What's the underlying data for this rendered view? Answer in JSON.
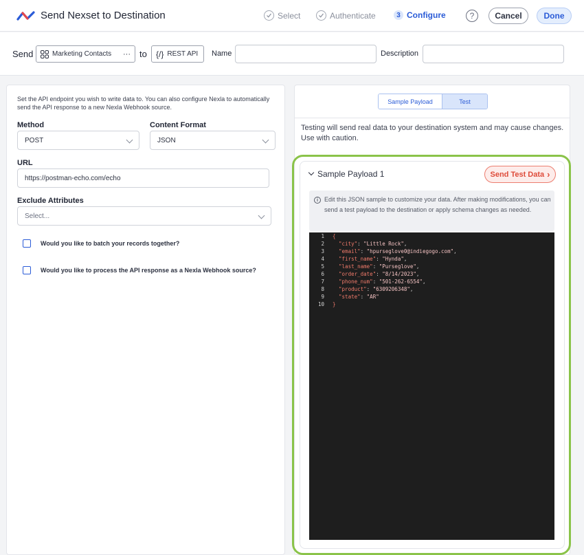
{
  "header": {
    "title": "Send Nexset to Destination",
    "steps": [
      {
        "label": "Select"
      },
      {
        "label": "Authenticate"
      },
      {
        "number": "3",
        "label": "Configure"
      }
    ],
    "help_icon_text": "?",
    "cancel_label": "Cancel",
    "done_label": "Done"
  },
  "send_bar": {
    "send_label": "Send",
    "source_name": "Marketing Contacts",
    "source_more": "···",
    "to_label": "to",
    "destination_icon_text": "{/}",
    "destination_name": "REST API",
    "name_label": "Name",
    "name_value": "",
    "description_label": "Description",
    "description_value": ""
  },
  "left_panel": {
    "intro": "Set the API endpoint you wish to write data to. You can also configure Nexla to automatically send the API response to a new Nexla Webhook source.",
    "method_label": "Method",
    "method_value": "POST",
    "content_format_label": "Content Format",
    "content_format_value": "JSON",
    "url_label": "URL",
    "url_value": "https://postman-echo.com/echo",
    "exclude_label": "Exclude Attributes",
    "exclude_placeholder": "Select...",
    "checkbox_batch": "Would you like to batch your records together?",
    "checkbox_webhook": "Would you like to process the API response as a Nexla Webhook source?"
  },
  "right_panel": {
    "tabs": [
      {
        "label": "Sample Payload",
        "active": false
      },
      {
        "label": "Test",
        "active": true
      }
    ],
    "warning": "Testing will send real data to your destination system and may cause changes. Use with caution.",
    "payload": {
      "title": "Sample Payload 1",
      "send_test_label": "Send Test Data",
      "send_test_chevron": "›",
      "info_icon_text": "i",
      "info_text": "Edit this JSON sample to customize your data. After making modifications, you can send a test payload to the destination or apply schema changes as needed.",
      "code_lines": [
        {
          "n": "1",
          "key": "",
          "value": "",
          "brace": "{"
        },
        {
          "n": "2",
          "key": "\"city\"",
          "value": "\"Little Rock\"",
          "comma": ","
        },
        {
          "n": "3",
          "key": "\"email\"",
          "value": "\"hpurseglove0@indiegogo.com\"",
          "comma": ","
        },
        {
          "n": "4",
          "key": "\"first_name\"",
          "value": "\"Hynda\"",
          "comma": ","
        },
        {
          "n": "5",
          "key": "\"last_name\"",
          "value": "\"Purseglove\"",
          "comma": ","
        },
        {
          "n": "6",
          "key": "\"order_date\"",
          "value": "\"8/14/2023\"",
          "comma": ","
        },
        {
          "n": "7",
          "key": "\"phone_num\"",
          "value": "\"501-262-6554\"",
          "comma": ","
        },
        {
          "n": "8",
          "key": "\"product\"",
          "value": "\"6309206348\"",
          "comma": ","
        },
        {
          "n": "9",
          "key": "\"state\"",
          "value": "\"AR\"",
          "comma": ""
        },
        {
          "n": "10",
          "key": "",
          "value": "",
          "brace": "}"
        }
      ]
    }
  },
  "colors": {
    "accent": "#2a5bd7",
    "highlight_border": "#8ac349",
    "danger": "#de4b3a",
    "editor_bg": "#1e1e1e"
  }
}
